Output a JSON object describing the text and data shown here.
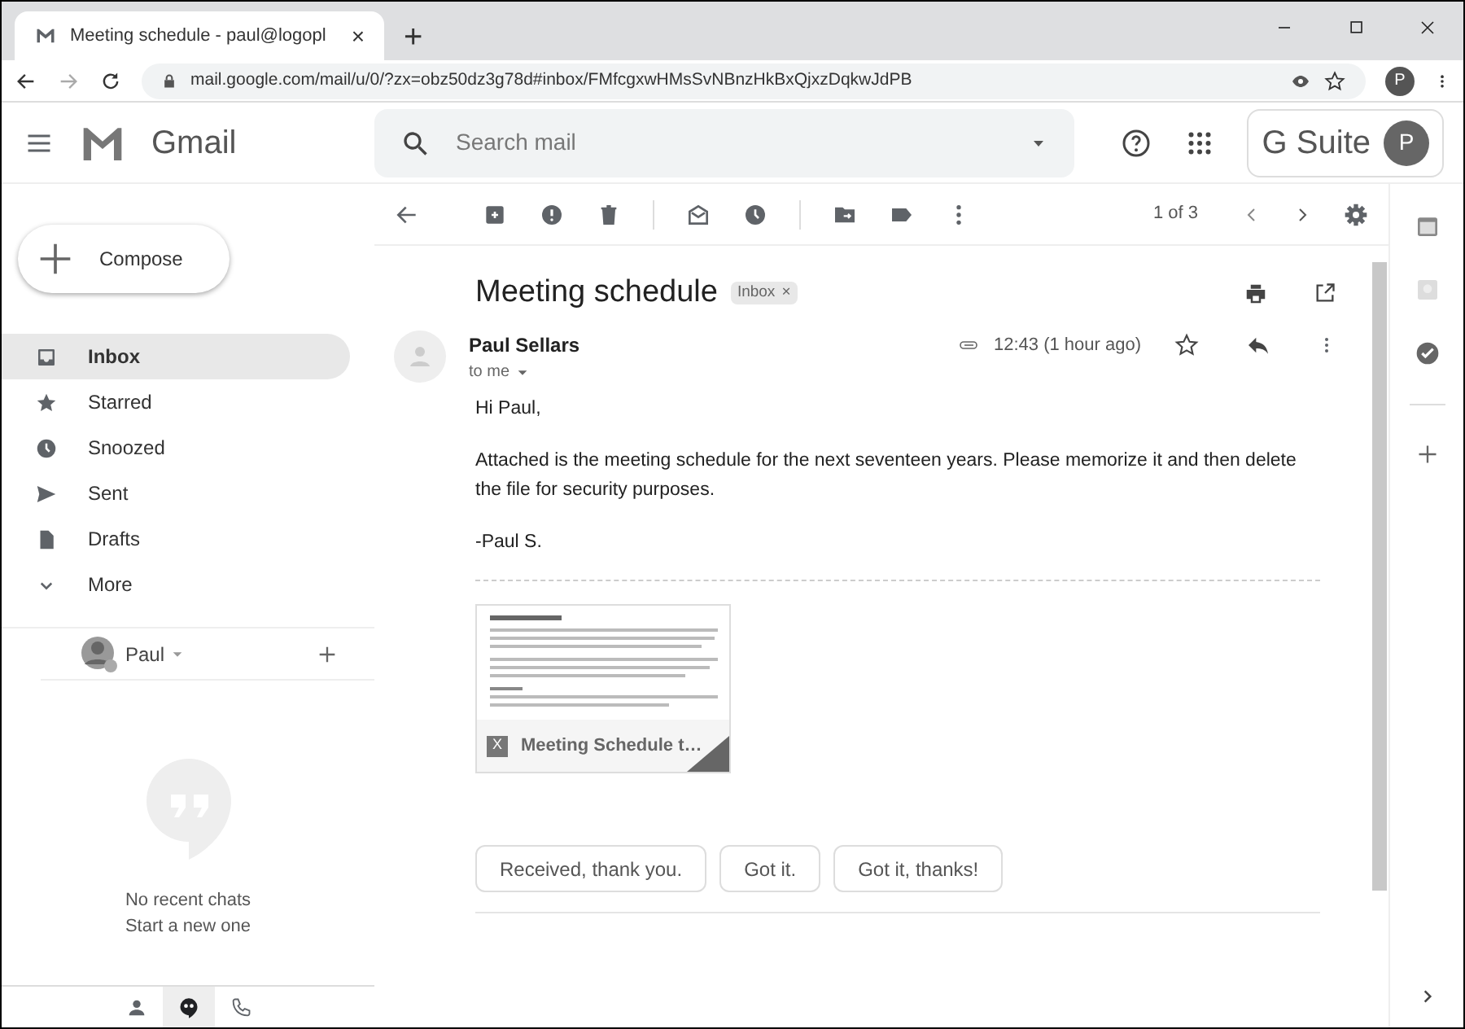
{
  "browser": {
    "tab_title": "Meeting schedule - paul@logopl",
    "tab_close": "×",
    "new_tab": "+",
    "url": "mail.google.com/mail/u/0/?zx=obz50dz3g78d#inbox/FMfcgxwHMsSvNBnzHkBxQjxzDqkwJdPB",
    "profile_initial": "P"
  },
  "header": {
    "app_name": "Gmail",
    "search_placeholder": "Search mail",
    "brand": "G Suite",
    "avatar_initial": "P"
  },
  "sidebar": {
    "compose": "Compose",
    "items": [
      {
        "kind": "inbox",
        "label": "Inbox",
        "selected": true
      },
      {
        "kind": "starred",
        "label": "Starred",
        "selected": false
      },
      {
        "kind": "snoozed",
        "label": "Snoozed",
        "selected": false
      },
      {
        "kind": "sent",
        "label": "Sent",
        "selected": false
      },
      {
        "kind": "drafts",
        "label": "Drafts",
        "selected": false
      },
      {
        "kind": "more",
        "label": "More",
        "selected": false
      }
    ],
    "hangouts": {
      "user": "Paul",
      "empty_title": "No recent chats",
      "empty_action": "Start a new one",
      "tabs": [
        {
          "kind": "contacts",
          "selected": false
        },
        {
          "kind": "chat",
          "selected": true
        },
        {
          "kind": "phone",
          "selected": false
        }
      ]
    }
  },
  "toolbar": {
    "pagination": "1 of 3"
  },
  "message": {
    "subject": "Meeting schedule",
    "label": "Inbox",
    "label_close": "×",
    "sender": "Paul Sellars",
    "recipient": "to me",
    "time": "12:43 (1 hour ago)",
    "body": [
      "Hi Paul,",
      "Attached is the meeting schedule for the next seventeen years. Please memorize it and then delete the file for security purposes.",
      "-Paul S."
    ],
    "attachment": {
      "type_badge": "X",
      "name": "Meeting Schedule t…"
    },
    "smart_replies": [
      "Received, thank you.",
      "Got it.",
      "Got it, thanks!"
    ]
  }
}
